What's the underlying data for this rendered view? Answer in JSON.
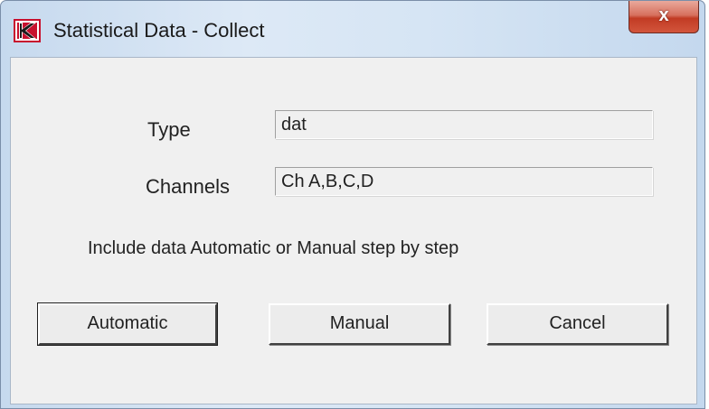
{
  "window": {
    "title": "Statistical Data - Collect",
    "close_label": "x"
  },
  "form": {
    "type_label": "Type",
    "type_value": "dat",
    "channels_label": "Channels",
    "channels_value": "Ch A,B,C,D",
    "info_text": "Include data Automatic or Manual step by step"
  },
  "buttons": {
    "automatic": "Automatic",
    "manual": "Manual",
    "cancel": "Cancel"
  },
  "colors": {
    "title_bar_tint": "#d6e5f4",
    "client_bg": "#f0f0f0",
    "close_red": "#c23b24",
    "app_icon_red": "#c8102e"
  },
  "icons": {
    "app": "k-logo-icon",
    "close": "close-icon"
  }
}
